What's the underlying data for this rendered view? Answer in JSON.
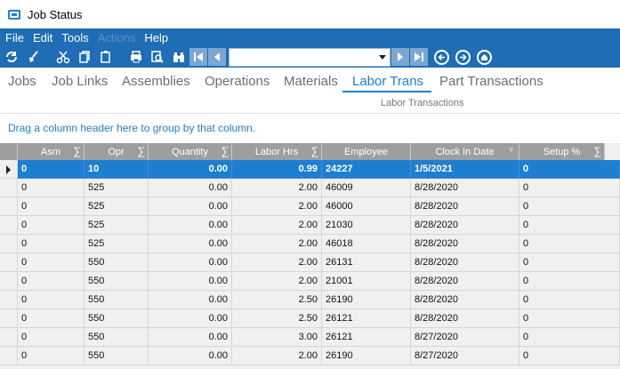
{
  "window": {
    "title": "Job Status"
  },
  "menu": [
    {
      "label": "File",
      "enabled": true
    },
    {
      "label": "Edit",
      "enabled": true
    },
    {
      "label": "Tools",
      "enabled": true
    },
    {
      "label": "Actions",
      "enabled": false
    },
    {
      "label": "Help",
      "enabled": true
    }
  ],
  "toolbar": {
    "combo_value": ""
  },
  "tabs": [
    {
      "label": "Jobs",
      "active": false
    },
    {
      "label": "Job Links",
      "active": false
    },
    {
      "label": "Assemblies",
      "active": false
    },
    {
      "label": "Operations",
      "active": false
    },
    {
      "label": "Materials",
      "active": false
    },
    {
      "label": "Labor Trans",
      "active": true
    },
    {
      "label": "Part Transactions",
      "active": false
    }
  ],
  "subtitle": "Labor Transactions",
  "group_hint": "Drag a column header here to group by that column.",
  "columns": [
    "Asm",
    "Opr",
    "Quantity",
    "Labor Hrs",
    "Employee",
    "Clock In Date",
    "Setup %"
  ],
  "rows": [
    [
      "0",
      "10",
      "0.00",
      "0.99",
      "24227",
      "1/5/2021",
      "0"
    ],
    [
      "0",
      "525",
      "0.00",
      "2.00",
      "46009",
      "8/28/2020",
      "0"
    ],
    [
      "0",
      "525",
      "0.00",
      "2.00",
      "46000",
      "8/28/2020",
      "0"
    ],
    [
      "0",
      "525",
      "0.00",
      "2.00",
      "21030",
      "8/28/2020",
      "0"
    ],
    [
      "0",
      "525",
      "0.00",
      "2.00",
      "46018",
      "8/28/2020",
      "0"
    ],
    [
      "0",
      "550",
      "0.00",
      "2.00",
      "26131",
      "8/28/2020",
      "0"
    ],
    [
      "0",
      "550",
      "0.00",
      "2.00",
      "21001",
      "8/28/2020",
      "0"
    ],
    [
      "0",
      "550",
      "0.00",
      "2.50",
      "26190",
      "8/28/2020",
      "0"
    ],
    [
      "0",
      "550",
      "0.00",
      "2.50",
      "26121",
      "8/28/2020",
      "0"
    ],
    [
      "0",
      "550",
      "0.00",
      "3.00",
      "26121",
      "8/27/2020",
      "0"
    ],
    [
      "0",
      "550",
      "0.00",
      "2.00",
      "26190",
      "8/27/2020",
      "0"
    ]
  ],
  "selected_row": 0,
  "colors": {
    "accent": "#1e7fd0",
    "menubar": "#1e6db5",
    "header": "#9e9e9e"
  }
}
